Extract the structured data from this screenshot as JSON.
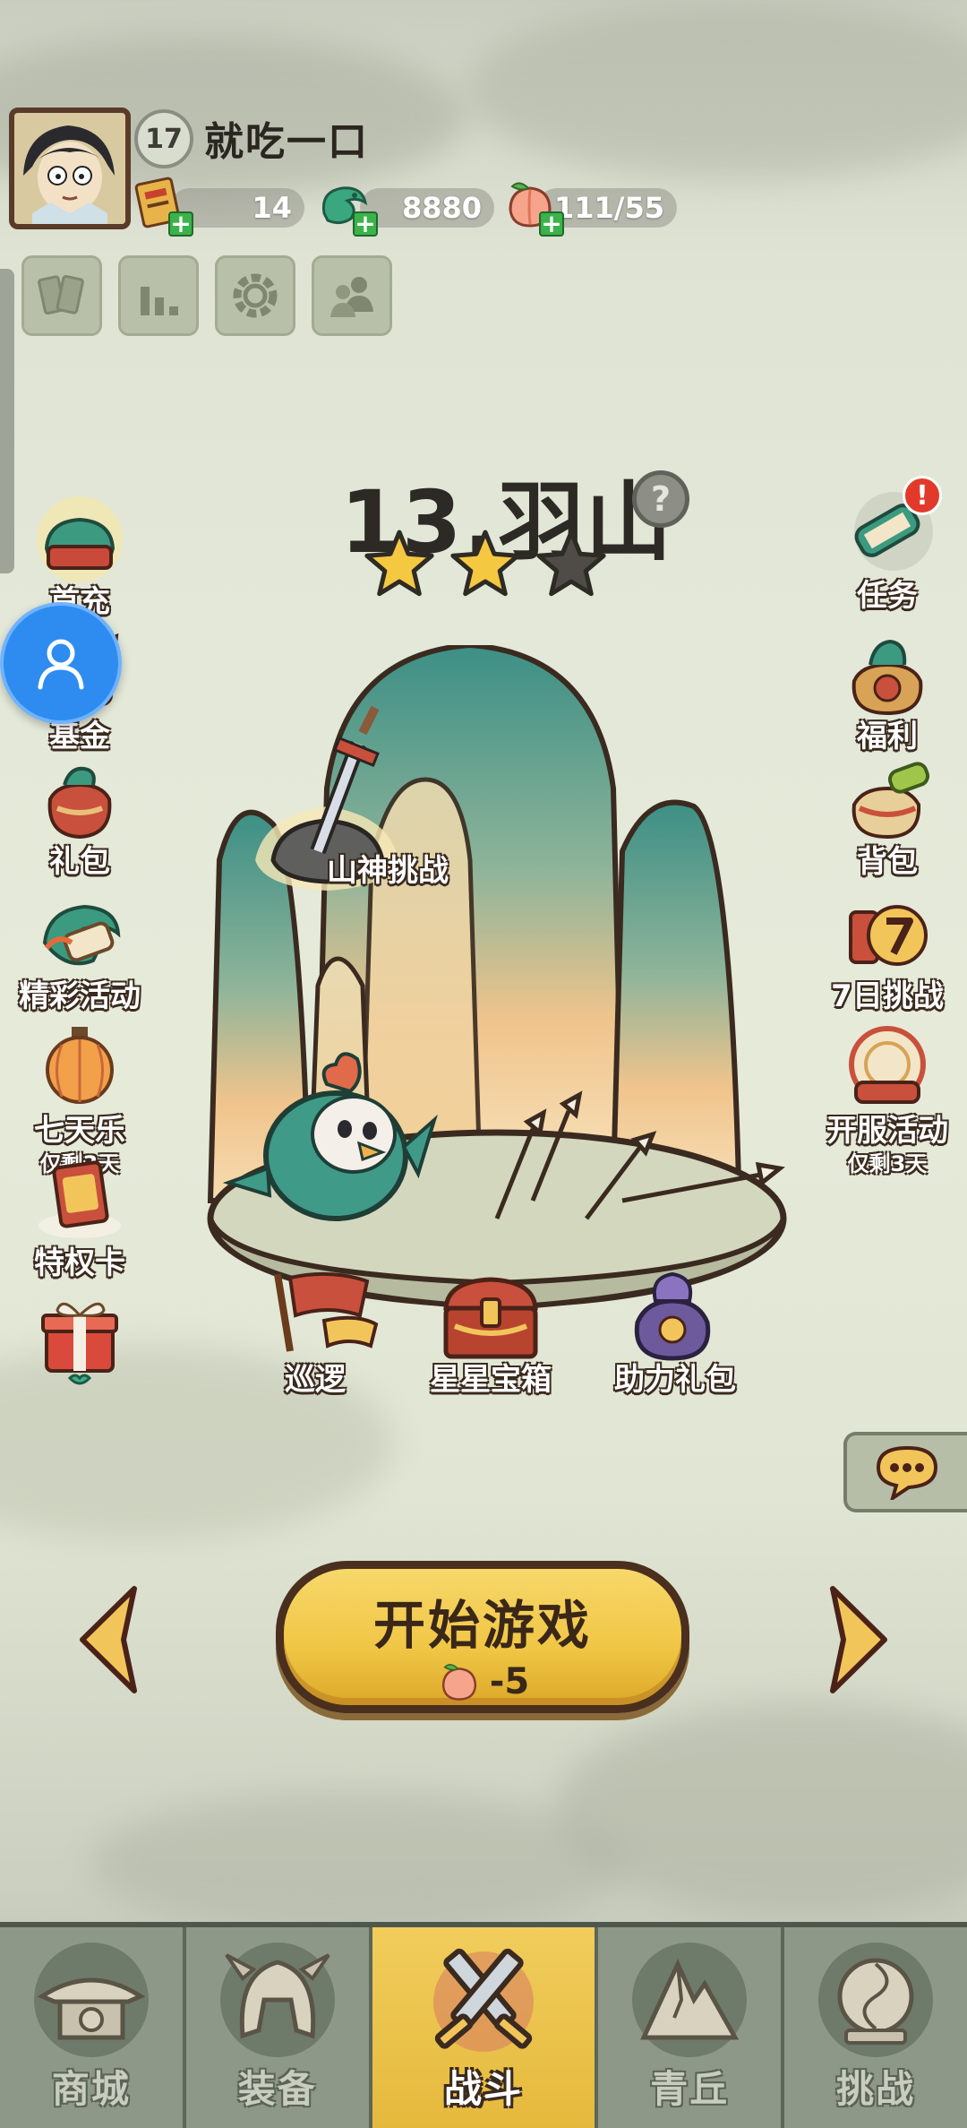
{
  "player": {
    "level": "17",
    "name": "就吃一口",
    "resources": [
      {
        "icon": "ticket-icon",
        "value": "14"
      },
      {
        "icon": "jade-dragon-icon",
        "value": "8880"
      },
      {
        "icon": "peach-stamina-icon",
        "value": "111/55"
      }
    ]
  },
  "toolbar": [
    {
      "icon": "cards-icon"
    },
    {
      "icon": "ranking-icon"
    },
    {
      "icon": "settings-gear-icon"
    },
    {
      "icon": "friends-icon"
    }
  ],
  "stage": {
    "title": "13.羽山",
    "help": "?",
    "stars_earned": 2,
    "stars_total": 3,
    "features": {
      "boss_challenge": "山神挑战",
      "patrol": "巡逻",
      "star_chest": "星星宝箱",
      "assist_pack": "助力礼包"
    }
  },
  "left_menu": [
    {
      "label": "首充",
      "sub": ""
    },
    {
      "label": "基金",
      "sub": ""
    },
    {
      "label": "礼包",
      "sub": ""
    },
    {
      "label": "精彩活动",
      "sub": ""
    },
    {
      "label": "七天乐",
      "sub": "仅剩3天"
    },
    {
      "label": "特权卡",
      "sub": ""
    },
    {
      "label": "",
      "sub": ""
    }
  ],
  "right_menu": [
    {
      "label": "任务",
      "sub": "",
      "badge": "!"
    },
    {
      "label": "福利",
      "sub": ""
    },
    {
      "label": "背包",
      "sub": ""
    },
    {
      "label": "7日挑战",
      "sub": ""
    },
    {
      "label": "开服活动",
      "sub": "仅剩3天"
    }
  ],
  "start": {
    "label": "开始游戏",
    "cost": "-5"
  },
  "bottom_nav": [
    {
      "label": "商城",
      "active": false
    },
    {
      "label": "装备",
      "active": false
    },
    {
      "label": "战斗",
      "active": true
    },
    {
      "label": "青丘",
      "active": false
    },
    {
      "label": "挑战",
      "active": false
    }
  ],
  "colors": {
    "gold": "#f0c544",
    "dark_outline": "#3a2a1f",
    "nav_bg": "#8d9889",
    "assistant_blue": "#2e8cf0"
  }
}
